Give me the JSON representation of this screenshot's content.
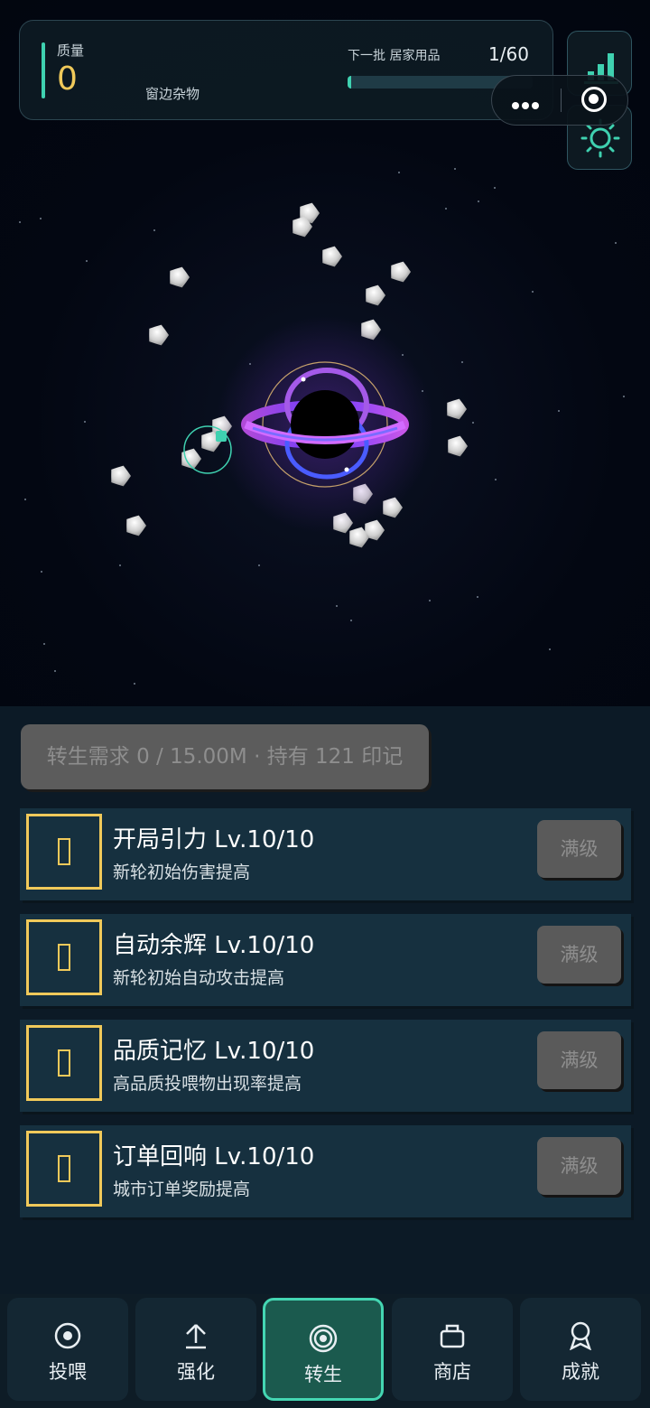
{
  "hud": {
    "mass_label": "质量",
    "mass_value": "0",
    "location": "窗边杂物",
    "next_label": "下一批 居家用品",
    "next_count": "1/60",
    "progress_fraction": 0.02
  },
  "icons": {
    "stats": "bar-chart-icon",
    "settings": "gear-icon",
    "menu": "more-icon",
    "close": "target-icon"
  },
  "colors": {
    "accent": "#3fd1b0",
    "gold": "#f0c95a",
    "disabled": "#5c5c5c"
  },
  "rebirth": {
    "requirement": "转生需求 0 / 15.00M · 持有 121 印记"
  },
  "upgrades": [
    {
      "name": "开局引力",
      "level": "Lv.10/10",
      "desc": "新轮初始伤害提高",
      "button": "满级"
    },
    {
      "name": "自动余辉",
      "level": "Lv.10/10",
      "desc": "新轮初始自动攻击提高",
      "button": "满级"
    },
    {
      "name": "品质记忆",
      "level": "Lv.10/10",
      "desc": "高品质投喂物出现率提高",
      "button": "满级"
    },
    {
      "name": "订单回响",
      "level": "Lv.10/10",
      "desc": "城市订单奖励提高",
      "button": "满级"
    }
  ],
  "nav": {
    "active": "转生",
    "items": [
      {
        "label": "投喂",
        "icon": "target-icon"
      },
      {
        "label": "强化",
        "icon": "upload-arrow-icon"
      },
      {
        "label": "转生",
        "icon": "ring-icon"
      },
      {
        "label": "商店",
        "icon": "shop-bag-icon"
      },
      {
        "label": "成就",
        "icon": "medal-icon"
      }
    ]
  }
}
